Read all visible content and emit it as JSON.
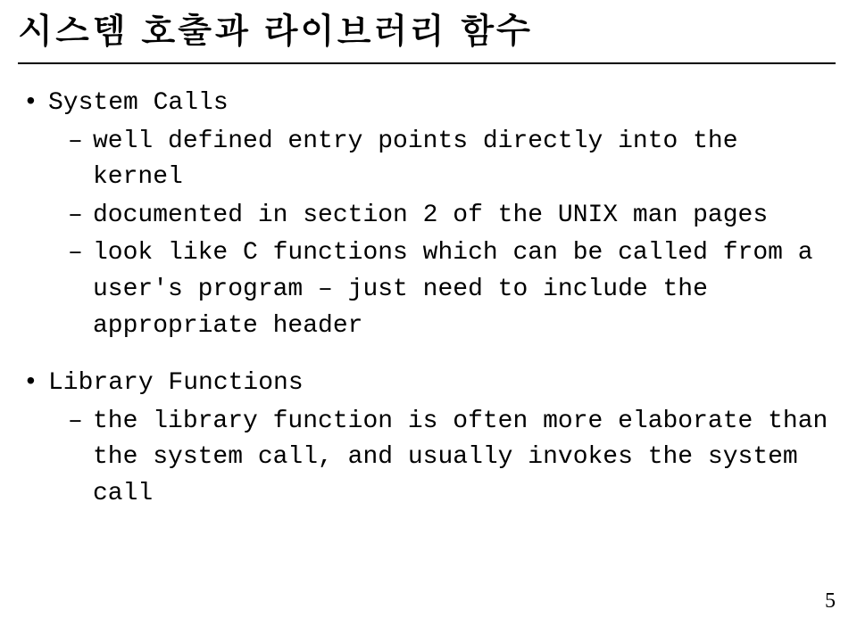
{
  "title": "시스템 호출과 라이브러리 함수",
  "sections": [
    {
      "heading": "System Calls",
      "items": [
        "well defined entry points directly into the kernel",
        "documented in section 2 of the UNIX man pages",
        "look like C functions which can be called from a user's program – just need to include the appropriate header"
      ]
    },
    {
      "heading": "Library Functions",
      "items": [
        "the library function is often more elaborate than the system call, and usually invokes the system call"
      ]
    }
  ],
  "page_number": "5"
}
